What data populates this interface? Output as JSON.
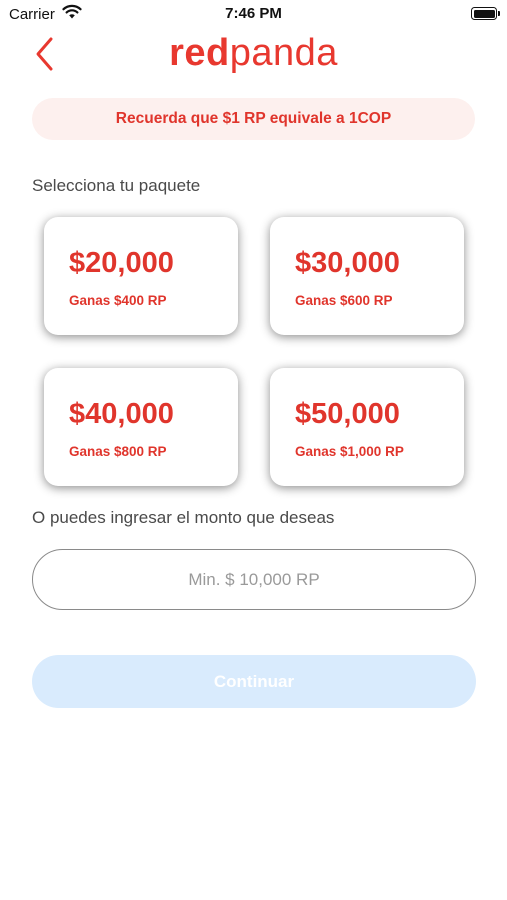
{
  "status_bar": {
    "carrier": "Carrier",
    "time": "7:46 PM"
  },
  "header": {
    "logo_part1": "red",
    "logo_part2": "panda"
  },
  "banner": {
    "text": "Recuerda que $1 RP equivale a 1COP"
  },
  "packages": {
    "label": "Selecciona tu paquete",
    "items": [
      {
        "amount": "$20,000",
        "reward": "Ganas $400 RP"
      },
      {
        "amount": "$30,000",
        "reward": "Ganas $600 RP"
      },
      {
        "amount": "$40,000",
        "reward": "Ganas $800 RP"
      },
      {
        "amount": "$50,000",
        "reward": "Ganas $1,000 RP"
      }
    ]
  },
  "custom_amount": {
    "label": "O puedes ingresar el monto que deseas",
    "value": "",
    "placeholder": "Min. $ 10,000 RP"
  },
  "continue_button": {
    "label": "Continuar"
  },
  "colors": {
    "brand": "#e8382f",
    "banner_bg": "#fdf0ee",
    "button_disabled_bg": "#d9ebfd"
  }
}
